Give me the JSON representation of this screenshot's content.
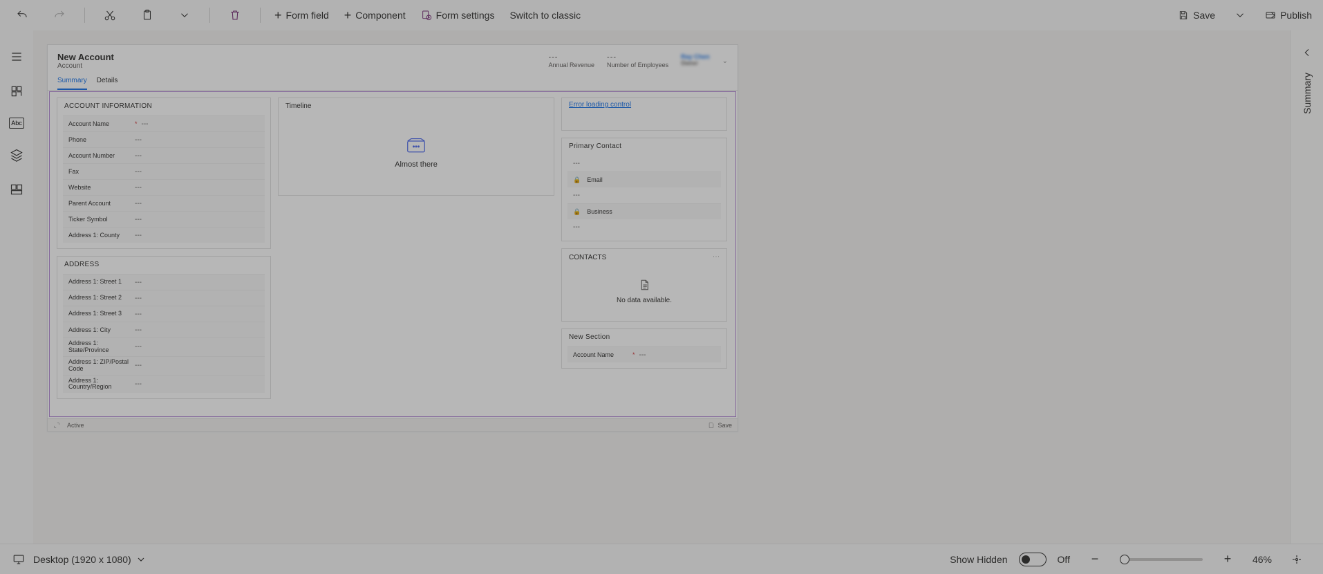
{
  "toolbar": {
    "form_field": "Form field",
    "component": "Component",
    "form_settings": "Form settings",
    "switch_classic": "Switch to classic",
    "save": "Save",
    "publish": "Publish"
  },
  "right_panel": {
    "title": "Summary"
  },
  "status": {
    "resolution_label": "Desktop (1920 x 1080)",
    "show_hidden_label": "Show Hidden",
    "show_hidden_value": "Off",
    "zoom": "46%"
  },
  "form": {
    "title": "New Account",
    "subtitle": "Account",
    "header_fields": [
      {
        "label": "Annual Revenue",
        "value": "---"
      },
      {
        "label": "Number of Employees",
        "value": "---"
      }
    ],
    "owner_blurred": "Ray Chen",
    "tabs": [
      "Summary",
      "Details"
    ],
    "active_tab": 0,
    "col1": {
      "sections": [
        {
          "title": "ACCOUNT INFORMATION",
          "fields": [
            {
              "label": "Account Name",
              "required": true,
              "value": "---"
            },
            {
              "label": "Phone",
              "value": "---"
            },
            {
              "label": "Account Number",
              "value": "---"
            },
            {
              "label": "Fax",
              "value": "---"
            },
            {
              "label": "Website",
              "value": "---"
            },
            {
              "label": "Parent Account",
              "value": "---"
            },
            {
              "label": "Ticker Symbol",
              "value": "---"
            },
            {
              "label": "Address 1: County",
              "value": "---"
            }
          ]
        },
        {
          "title": "ADDRESS",
          "fields": [
            {
              "label": "Address 1: Street 1",
              "value": "---"
            },
            {
              "label": "Address 1: Street 2",
              "value": "---"
            },
            {
              "label": "Address 1: Street 3",
              "value": "---"
            },
            {
              "label": "Address 1: City",
              "value": "---"
            },
            {
              "label": "Address 1: State/Province",
              "value": "---"
            },
            {
              "label": "Address 1: ZIP/Postal Code",
              "value": "---"
            },
            {
              "label": "Address 1: Country/Region",
              "value": "---"
            }
          ]
        }
      ]
    },
    "col2": {
      "timeline_title": "Timeline",
      "timeline_msg": "Almost there"
    },
    "col3": {
      "error_text": "Error loading control",
      "primary_contact": {
        "label": "Primary Contact",
        "value": "---",
        "email_label": "Email",
        "email_value": "---",
        "business_label": "Business",
        "business_value": "---"
      },
      "contacts_title": "CONTACTS",
      "no_data": "No data available.",
      "new_section_title": "New Section",
      "new_section_field": {
        "label": "Account Name",
        "required": true,
        "value": "---"
      }
    },
    "footer": {
      "status_label": "Active",
      "save_label": "Save"
    }
  }
}
